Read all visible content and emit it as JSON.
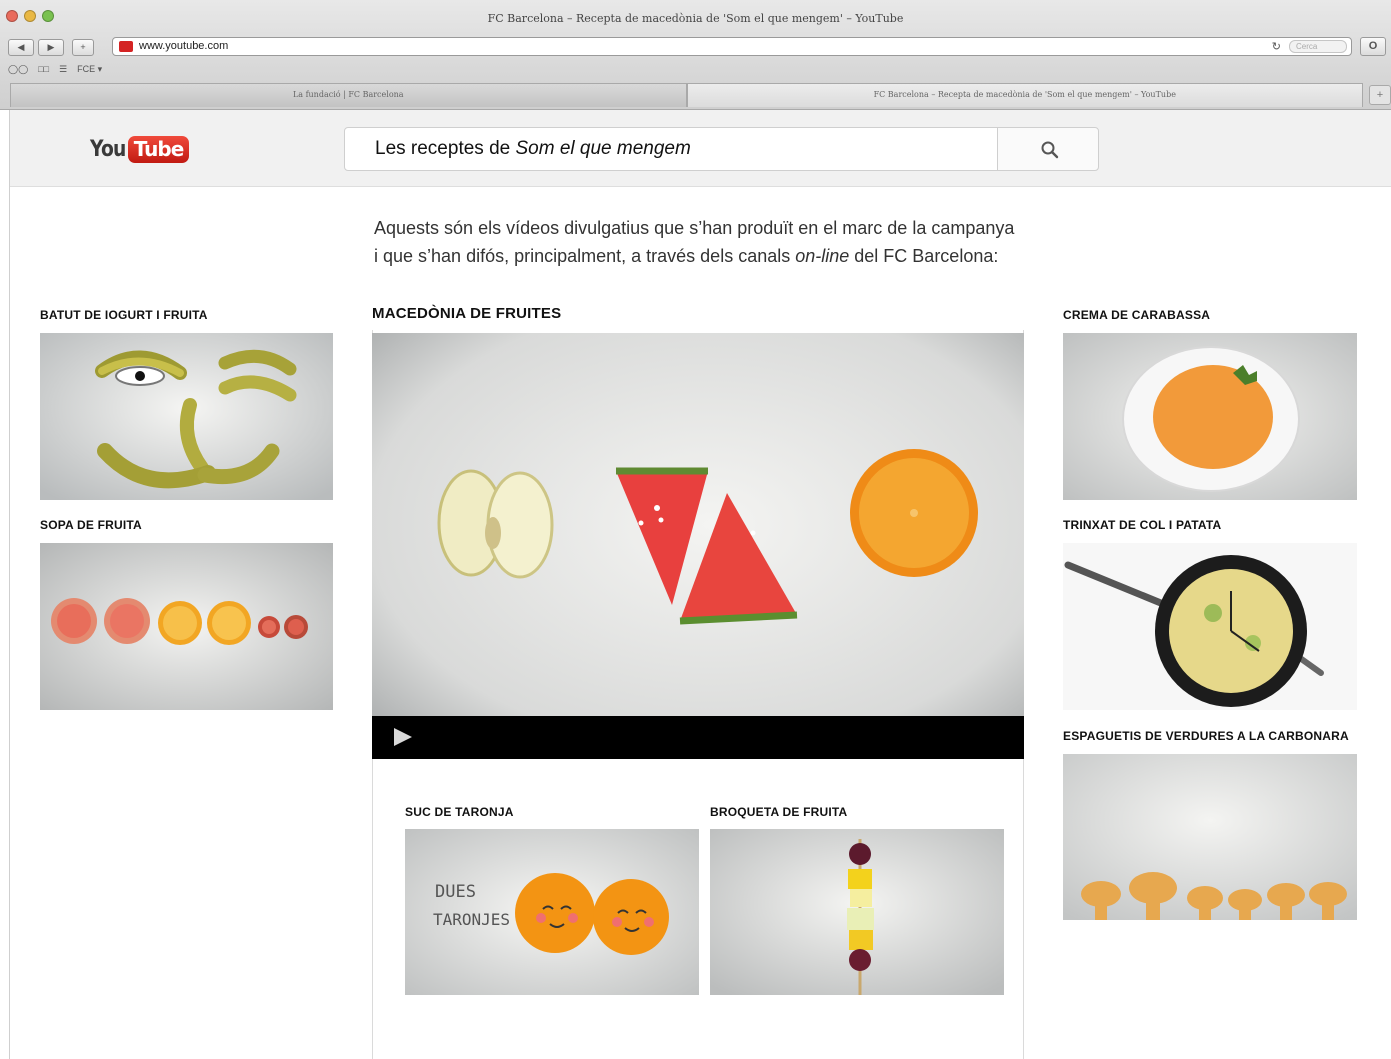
{
  "browser": {
    "window_title": "FC Barcelona – Recepta de macedònia de 'Som el que mengem' – YouTube",
    "url": "www.youtube.com",
    "bookmark": "FCE",
    "search_placeholder": "Cerca",
    "tabs": [
      {
        "label": "La fundació | FC Barcelona"
      },
      {
        "label": "FC Barcelona – Recepta de macedònia de 'Som el que mengem' – YouTube"
      }
    ],
    "new_tab": "+"
  },
  "youtube": {
    "logo_you": "You",
    "logo_tube": "Tube",
    "search_prefix": "Les receptes de ",
    "search_title": "Som el que mengem"
  },
  "intro": {
    "line1": "Aquests són els vídeos divulgatius que s’han produït en el marc de la campanya",
    "line2_a": "i que s’han difós, principalment, a través dels canals ",
    "line2_em": "on-line",
    "line2_b": " del FC Barcelona:"
  },
  "videos": {
    "main": "Macedònia de fruites",
    "left": [
      "Batut de iogurt i fruita",
      "Sopa de fruita"
    ],
    "right": [
      "Crema de carabassa",
      "Trinxat de col i patata",
      "Espaguetis de verdures a la carbonara"
    ],
    "bottom": [
      "Suc de taronja",
      "Broqueta de fruita"
    ]
  },
  "thumb_text": {
    "dues": "DUES",
    "taronjes": "TARONJES"
  }
}
